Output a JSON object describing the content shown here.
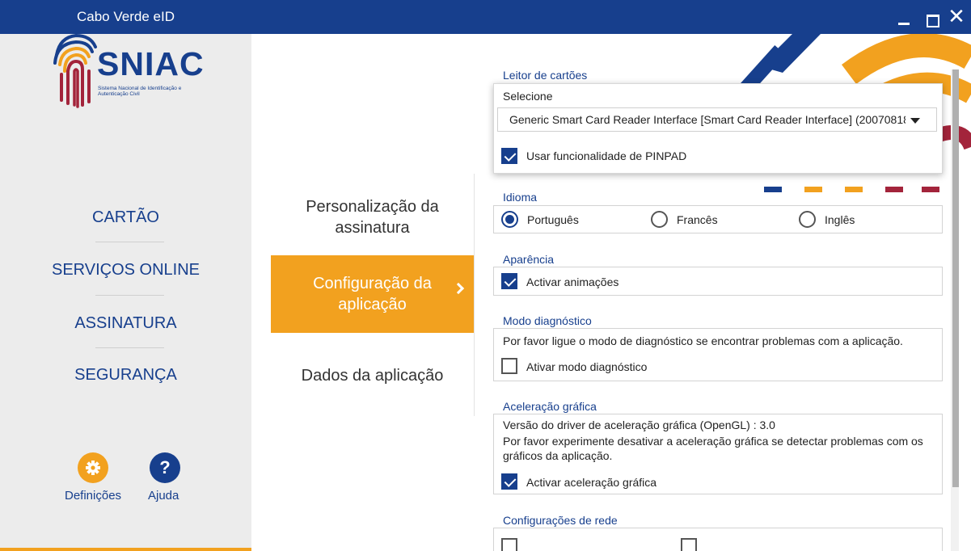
{
  "window": {
    "title": "Cabo Verde eID",
    "min_symbol": "",
    "close_symbol": "✕"
  },
  "logo": {
    "name": "SNIAC",
    "subtitle": "Sistema Nacional de Identificação e Autenticação Civil"
  },
  "sidebar": {
    "items": [
      {
        "label": "CARTÃO"
      },
      {
        "label": "SERVIÇOS ONLINE"
      },
      {
        "label": "ASSINATURA"
      },
      {
        "label": "SEGURANÇA"
      }
    ],
    "settings_label": "Definições",
    "help_label": "Ajuda",
    "help_symbol": "?"
  },
  "submenu": {
    "items": [
      {
        "label": "Personalização da assinatura"
      },
      {
        "label": "Configuração da aplicação",
        "active": true
      },
      {
        "label": "Dados da aplicação"
      }
    ]
  },
  "settings": {
    "card_reader": {
      "title": "Leitor de cartões",
      "select_label": "Selecione",
      "selected": "Generic Smart Card Reader Interface [Smart Card Reader Interface] (20070818",
      "pinpad_label": "Usar funcionalidade de PINPAD",
      "pinpad_checked": true
    },
    "language": {
      "title": "Idioma",
      "options": [
        "Português",
        "Francês",
        "Inglês"
      ],
      "selected": "Português"
    },
    "appearance": {
      "title": "Aparência",
      "animations_label": "Activar animações",
      "animations_checked": true
    },
    "diagnostic": {
      "title": "Modo diagnóstico",
      "description": "Por favor ligue o modo de diagnóstico se encontrar problemas com a aplicação.",
      "toggle_label": "Ativar modo diagnóstico",
      "checked": false
    },
    "graphics": {
      "title": "Aceleração gráfica",
      "driver_version": "Versão do driver de aceleração gráfica (OpenGL) : 3.0",
      "description_line1": "Por favor experimente desativar a aceleração gráfica se detectar problemas com os",
      "description_line2": "gráficos da aplicação.",
      "toggle_label": "Activar aceleração gráfica",
      "checked": true
    },
    "network": {
      "title": "Configurações de rede"
    }
  },
  "colors": {
    "brand_blue": "#173f8d",
    "accent_orange": "#f2a11f",
    "accent_red": "#a3243b"
  },
  "icons": {
    "settings": "gear-icon",
    "help": "question-icon",
    "submenu_active": "chevron-right-icon",
    "dropdown": "caret-down-icon"
  }
}
